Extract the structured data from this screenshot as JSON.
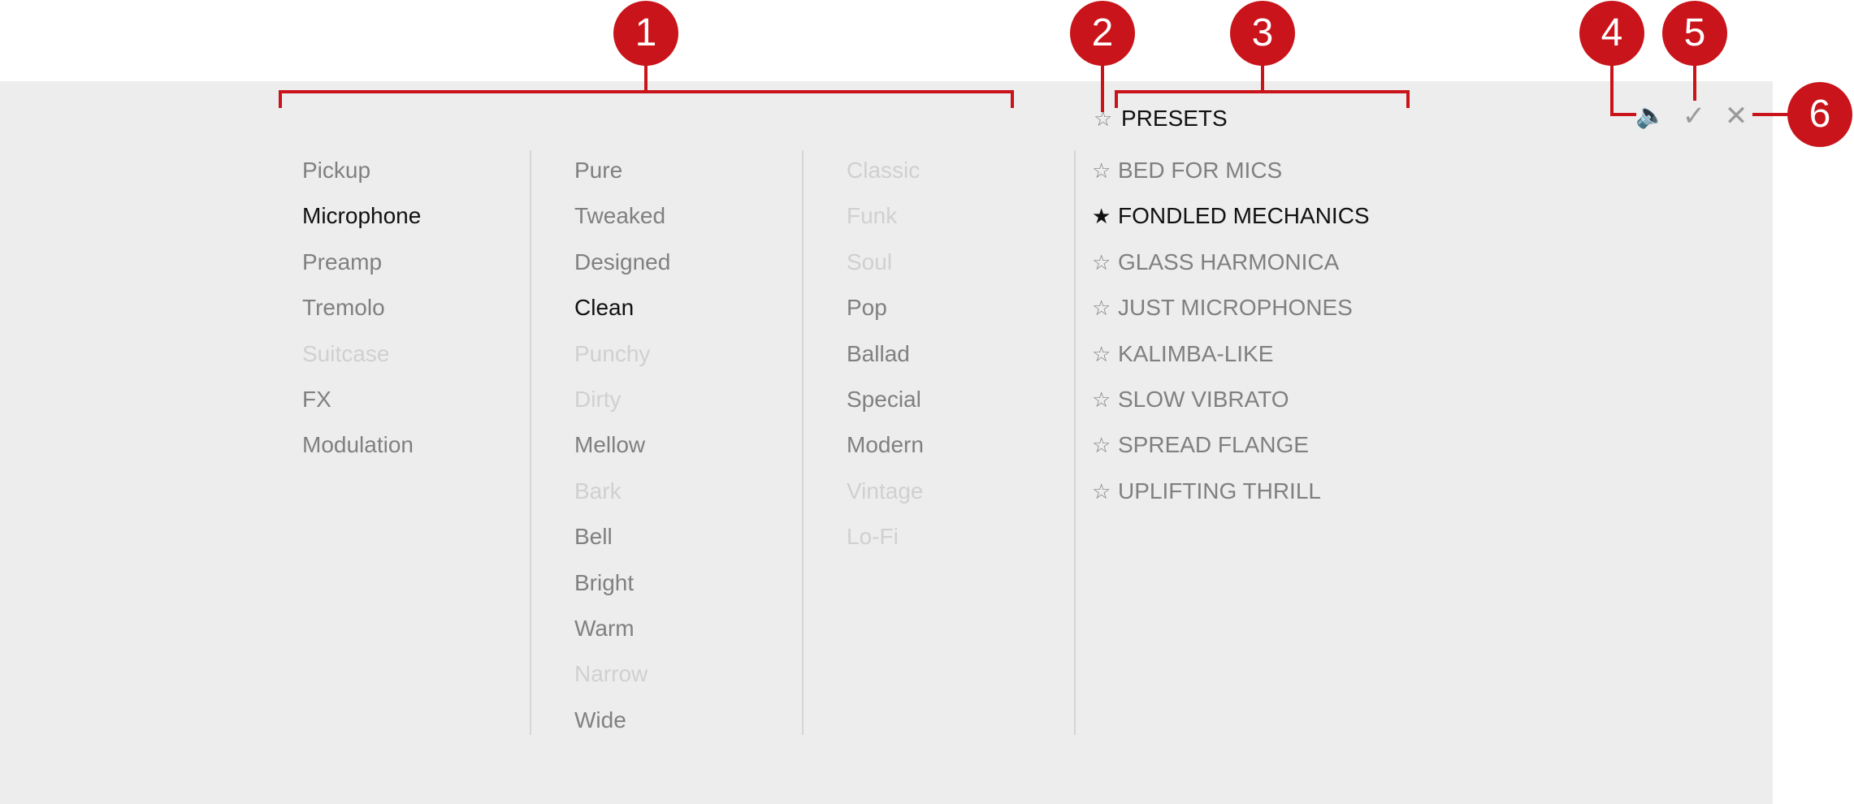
{
  "columns": [
    {
      "items": [
        {
          "label": "Pickup",
          "state": "normal"
        },
        {
          "label": "Microphone",
          "state": "selected"
        },
        {
          "label": "Preamp",
          "state": "normal"
        },
        {
          "label": "Tremolo",
          "state": "normal"
        },
        {
          "label": "Suitcase",
          "state": "disabled"
        },
        {
          "label": "FX",
          "state": "normal"
        },
        {
          "label": "Modulation",
          "state": "normal"
        }
      ]
    },
    {
      "items": [
        {
          "label": "Pure",
          "state": "normal"
        },
        {
          "label": "Tweaked",
          "state": "normal"
        },
        {
          "label": "Designed",
          "state": "normal"
        },
        {
          "label": "Clean",
          "state": "selected"
        },
        {
          "label": "Punchy",
          "state": "disabled"
        },
        {
          "label": "Dirty",
          "state": "disabled"
        },
        {
          "label": "Mellow",
          "state": "normal"
        },
        {
          "label": "Bark",
          "state": "disabled"
        },
        {
          "label": "Bell",
          "state": "normal"
        },
        {
          "label": "Bright",
          "state": "normal"
        },
        {
          "label": "Warm",
          "state": "normal"
        },
        {
          "label": "Narrow",
          "state": "disabled"
        },
        {
          "label": "Wide",
          "state": "normal"
        }
      ]
    },
    {
      "items": [
        {
          "label": "Classic",
          "state": "disabled"
        },
        {
          "label": "Funk",
          "state": "disabled"
        },
        {
          "label": "Soul",
          "state": "disabled"
        },
        {
          "label": "Pop",
          "state": "normal"
        },
        {
          "label": "Ballad",
          "state": "normal"
        },
        {
          "label": "Special",
          "state": "normal"
        },
        {
          "label": "Modern",
          "state": "normal"
        },
        {
          "label": "Vintage",
          "state": "disabled"
        },
        {
          "label": "Lo-Fi",
          "state": "disabled"
        }
      ]
    }
  ],
  "presets": {
    "title": "PRESETS",
    "title_star": "☆",
    "items": [
      {
        "label": "BED FOR MICS",
        "star": "☆",
        "selected": false
      },
      {
        "label": "FONDLED MECHANICS",
        "star": "★",
        "selected": true
      },
      {
        "label": "GLASS HARMONICA",
        "star": "☆",
        "selected": false
      },
      {
        "label": "JUST MICROPHONES",
        "star": "☆",
        "selected": false
      },
      {
        "label": "KALIMBA-LIKE",
        "star": "☆",
        "selected": false
      },
      {
        "label": "SLOW VIBRATO",
        "star": "☆",
        "selected": false
      },
      {
        "label": "SPREAD FLANGE",
        "star": "☆",
        "selected": false
      },
      {
        "label": "UPLIFTING THRILL",
        "star": "☆",
        "selected": false
      }
    ]
  },
  "toolbar": {
    "speaker_icon": "speaker-icon",
    "confirm_icon": "check-icon",
    "close_icon": "close-icon",
    "speaker_glyph": "🔈",
    "confirm_glyph": "✓",
    "close_glyph": "✕"
  },
  "callouts": [
    "1",
    "2",
    "3",
    "4",
    "5",
    "6"
  ],
  "colors": {
    "callout_red": "#c8141a",
    "panel_bg": "#ededed",
    "selected_text": "#111111",
    "normal_text": "#808080",
    "disabled_text": "#d0d0d0"
  }
}
